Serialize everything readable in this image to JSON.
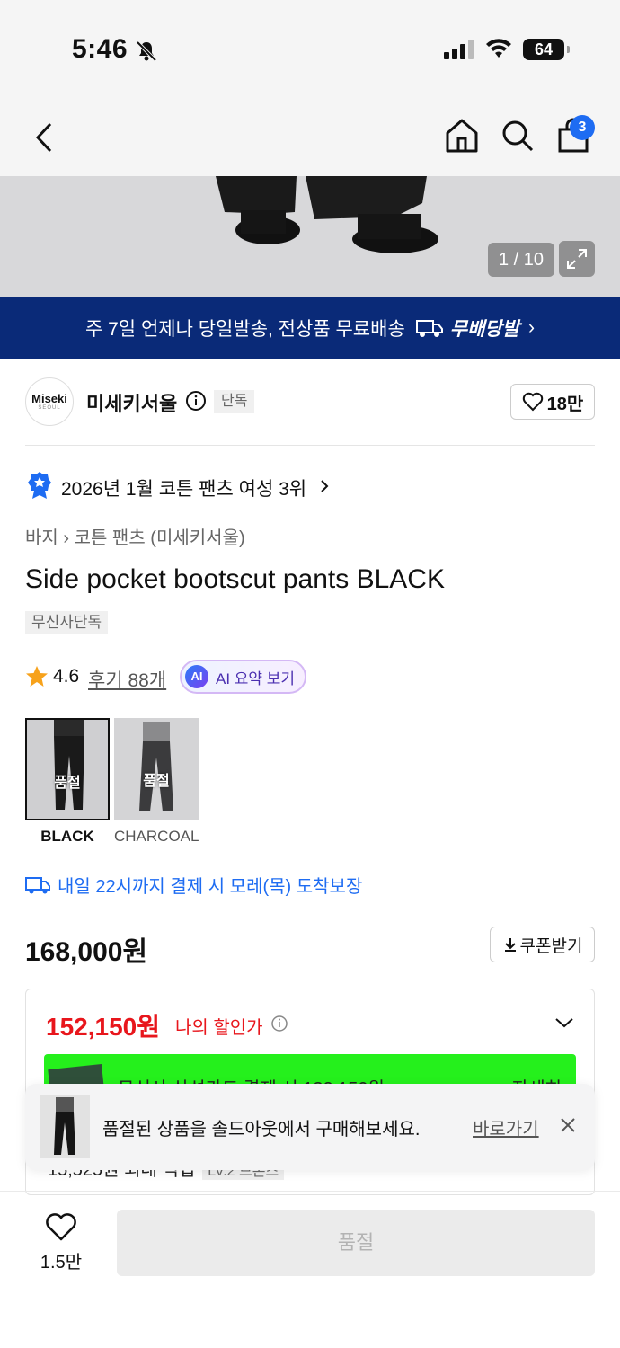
{
  "status_bar": {
    "time": "5:46",
    "battery": "64"
  },
  "nav": {
    "cart_count": "3"
  },
  "hero": {
    "counter": "1 / 10"
  },
  "banner": {
    "text": "주 7일 언제나 당일발송, 전상품 무료배송",
    "brand": "무배당발",
    "chevron": "›"
  },
  "brand": {
    "logo_text": "Miseki",
    "logo_sub": "SEOUL",
    "name": "미세키서울",
    "tag": "단독",
    "likes": "18만"
  },
  "ranking": {
    "text": "2026년 1월 코튼 팬츠 여성 3위"
  },
  "breadcrumb": "바지 › 코튼 팬츠 (미세키서울)",
  "product": {
    "title": "Side pocket bootscut pants BLACK",
    "exclusive_tag": "무신사단독",
    "rating": "4.6",
    "reviews": "후기 88개",
    "ai_badge": "AI",
    "ai_label": "AI 요약 보기"
  },
  "options": [
    {
      "name": "BLACK",
      "status": "품절",
      "selected": true
    },
    {
      "name": "CHARCOAL",
      "status": "품절",
      "selected": false
    }
  ],
  "delivery": "내일 22시까지 결제 시 모레(목) 도착보장",
  "pricing": {
    "price": "168,000원",
    "coupon_button": "쿠폰받기",
    "my_price": "152,150원",
    "my_price_label": "나의 할인가",
    "card_promo": "무신사 삼성카드 결제 시 132,150원",
    "card_promo_more": "자세히",
    "reward": "15,525원 최대 적립",
    "reward_level": "LV.2 브론즈"
  },
  "toast": {
    "text": "품절된 상품을 솔드아웃에서 구매해보세요.",
    "link": "바로가기"
  },
  "bottom": {
    "likes": "1.5만",
    "soldout_button": "품절"
  },
  "colors": {
    "accent_blue": "#1e6cf2",
    "banner_navy": "#0a2a78",
    "sale_red": "#e8161c",
    "promo_green": "#25f01c"
  }
}
